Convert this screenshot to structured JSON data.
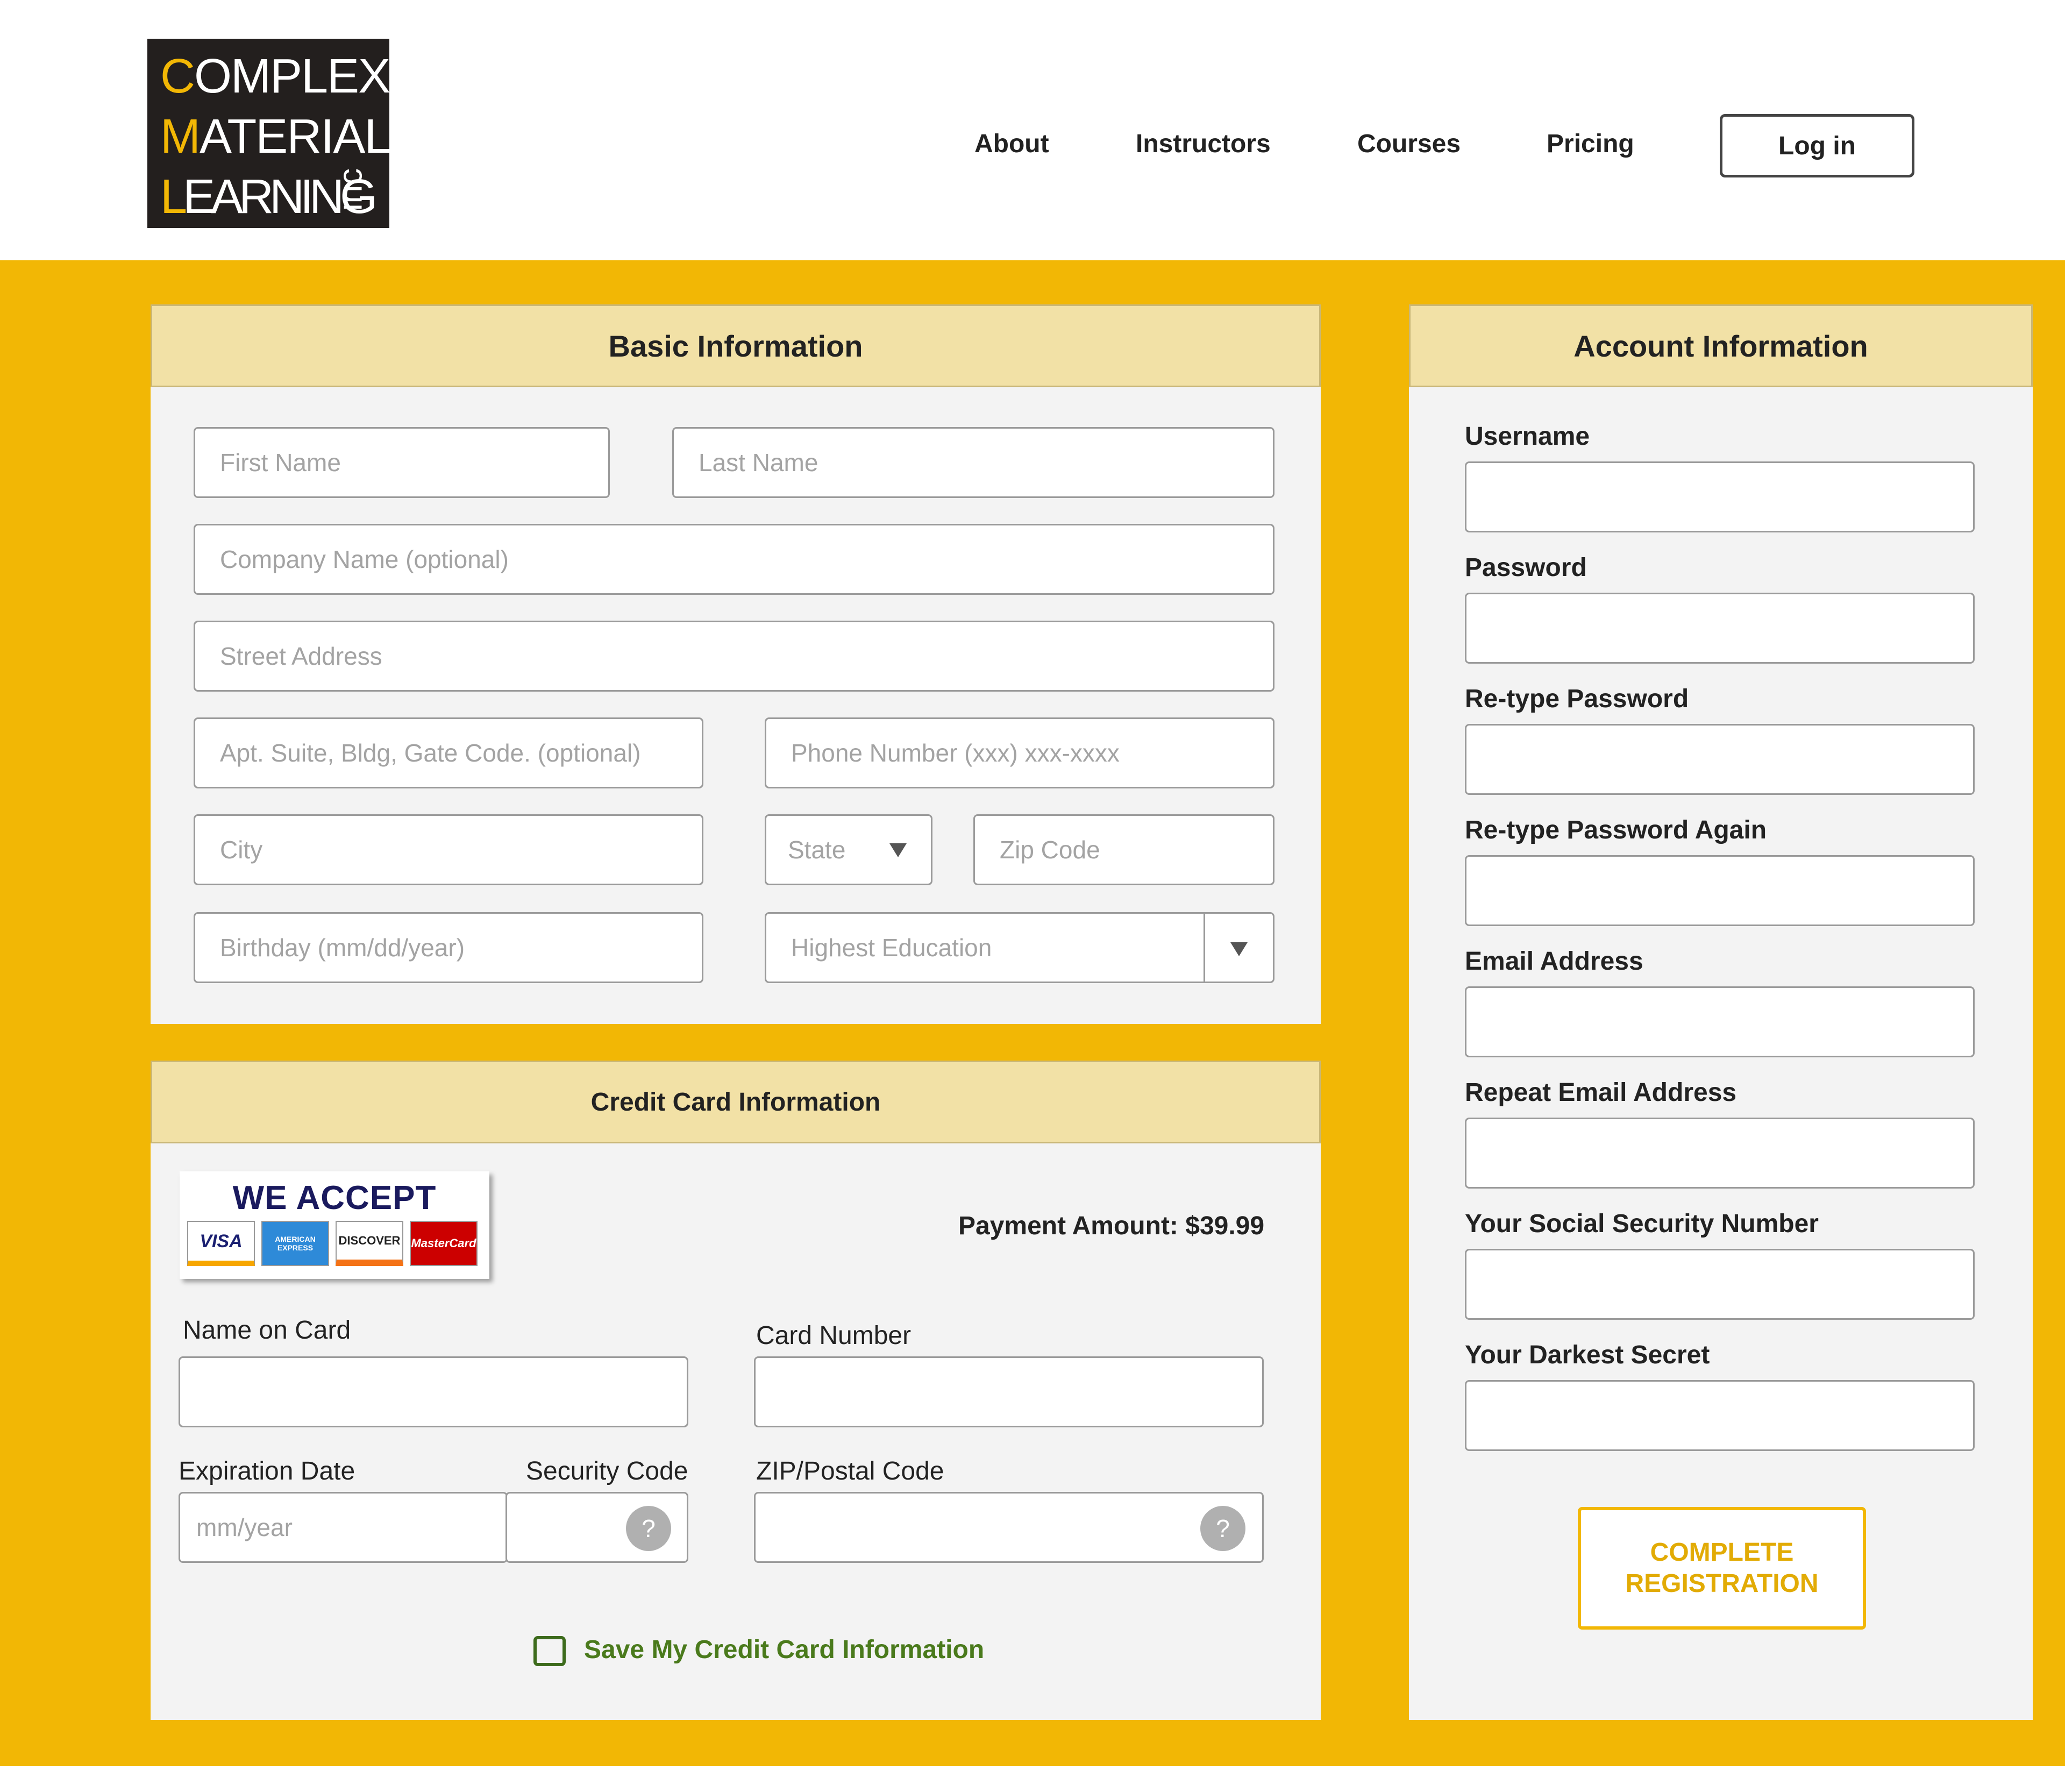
{
  "brand": {
    "line1_first": "C",
    "line1_rest": "OMPLEX",
    "line2_first": "M",
    "line2_rest": "ATERIAL",
    "line3_first": "L",
    "line3_rest": "EARNING",
    "suffix": "inc"
  },
  "nav": {
    "items": [
      "About",
      "Instructors",
      "Courses",
      "Pricing"
    ],
    "login": "Log in"
  },
  "basic": {
    "title": "Basic Information",
    "first_name": "First Name",
    "last_name": "Last Name",
    "company": "Company Name (optional)",
    "street": "Street Address",
    "apt": "Apt. Suite, Bldg, Gate Code. (optional)",
    "phone": "Phone Number (xxx) xxx-xxxx",
    "city": "City",
    "state": "State",
    "zip": "Zip Code",
    "birthday": "Birthday (mm/dd/year)",
    "education": "Highest Education"
  },
  "credit": {
    "title": "Credit Card Information",
    "we_accept": "WE ACCEPT",
    "cards": [
      "VISA",
      "AMERICAN EXPRESS",
      "DISCOVER",
      "MasterCard"
    ],
    "payment_amount": "Payment Amount: $39.99",
    "name_on_card": "Name on Card",
    "card_number": "Card Number",
    "expiration_date": "Expiration Date",
    "security_code": "Security Code",
    "zip_postal": "ZIP/Postal Code",
    "expiration_placeholder": "mm/year",
    "help_icon": "?",
    "save_label": "Save My Credit Card Information"
  },
  "account": {
    "title": "Account Information",
    "fields": [
      "Username",
      "Password",
      "Re-type Password",
      "Re-type Password Again",
      "Email Address",
      "Repeat Email Address",
      "Your Social Security Number",
      "Your Darkest Secret"
    ],
    "submit_line1": "COMPLETE",
    "submit_line2": "REGISTRATION"
  },
  "colors": {
    "accent": "#f2b705",
    "panel_header": "#f2e1a6",
    "panel_bg": "#f3f3f3",
    "logo_bg": "#231f1e",
    "save_green": "#4a7a1c"
  }
}
